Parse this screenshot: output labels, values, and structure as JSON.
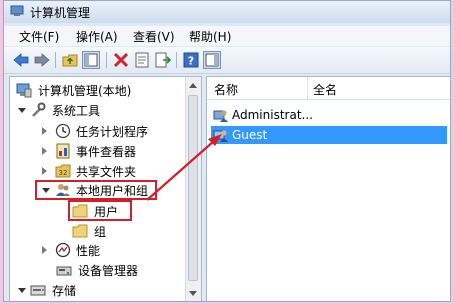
{
  "window": {
    "title": "计算机管理"
  },
  "menu": {
    "file": "文件(F)",
    "action": "操作(A)",
    "view": "查看(V)",
    "help": "帮助(H)"
  },
  "tree": {
    "root": "计算机管理(本地)",
    "system_tools": "系统工具",
    "task_scheduler": "任务计划程序",
    "event_viewer": "事件查看器",
    "shared_folders": "共享文件夹",
    "local_users_groups": "本地用户和组",
    "users": "用户",
    "groups": "组",
    "performance": "性能",
    "device_manager": "设备管理器",
    "storage": "存储"
  },
  "list": {
    "col_name": "名称",
    "col_fullname": "全名",
    "rows": [
      {
        "name": "Administrat...",
        "selected": false
      },
      {
        "name": "Guest",
        "selected": true
      }
    ]
  },
  "colors": {
    "selection": "#3399ff",
    "highlight_red": "#d0202a",
    "titlebar": "#dfe9f5"
  }
}
